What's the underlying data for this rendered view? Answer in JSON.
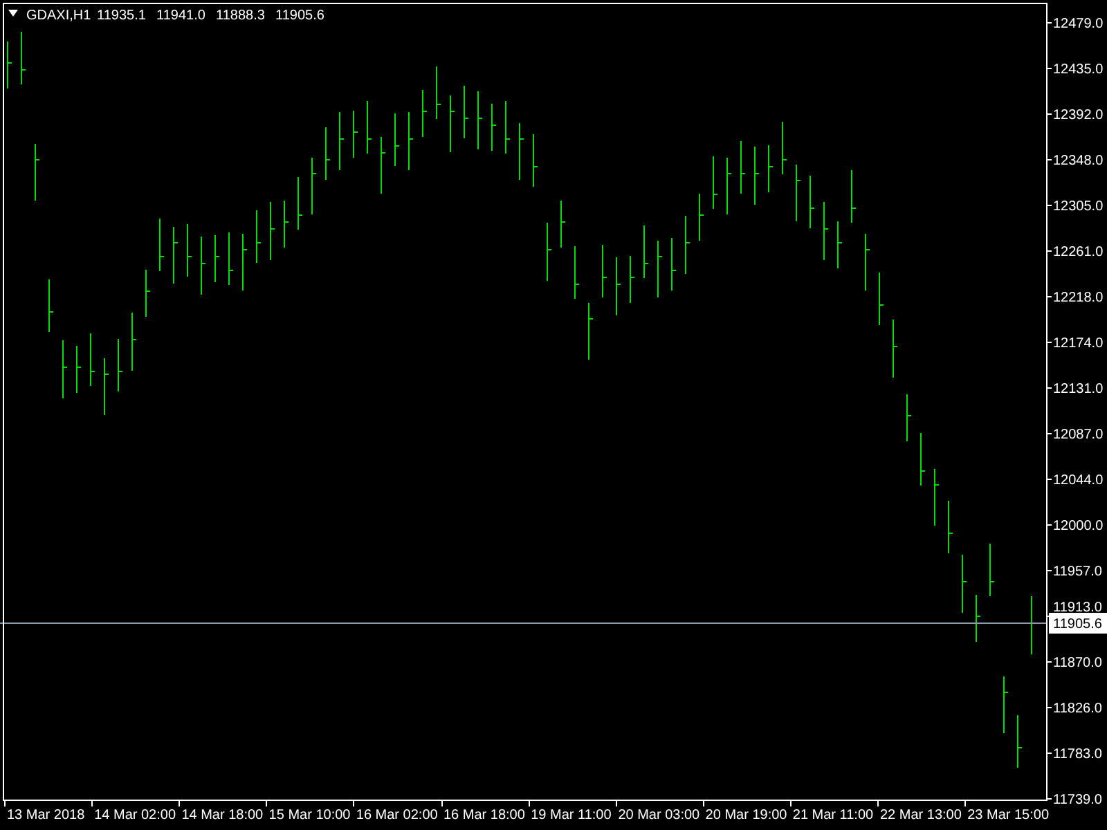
{
  "chart": {
    "symbol": "GDAXI,H1",
    "quote": [
      "11935.1",
      "11941.0",
      "11888.3",
      "11905.6"
    ],
    "price_label": "11905.6",
    "price_scale": [
      "12479.0",
      "12435.0",
      "12392.0",
      "12348.0",
      "12305.0",
      "12261.0",
      "12218.0",
      "12174.0",
      "12131.0",
      "12087.0",
      "12044.0",
      "12000.0",
      "11957.0",
      "11913.0",
      "11870.0",
      "11826.0",
      "11783.0",
      "11739.0"
    ],
    "time_scale": [
      "13 Mar 2018",
      "14 Mar 02:00",
      "14 Mar 18:00",
      "15 Mar 10:00",
      "16 Mar 02:00",
      "16 Mar 18:00",
      "19 Mar 11:00",
      "20 Mar 03:00",
      "20 Mar 19:00",
      "21 Mar 11:00",
      "22 Mar 13:00",
      "23 Mar 15:00"
    ]
  }
}
